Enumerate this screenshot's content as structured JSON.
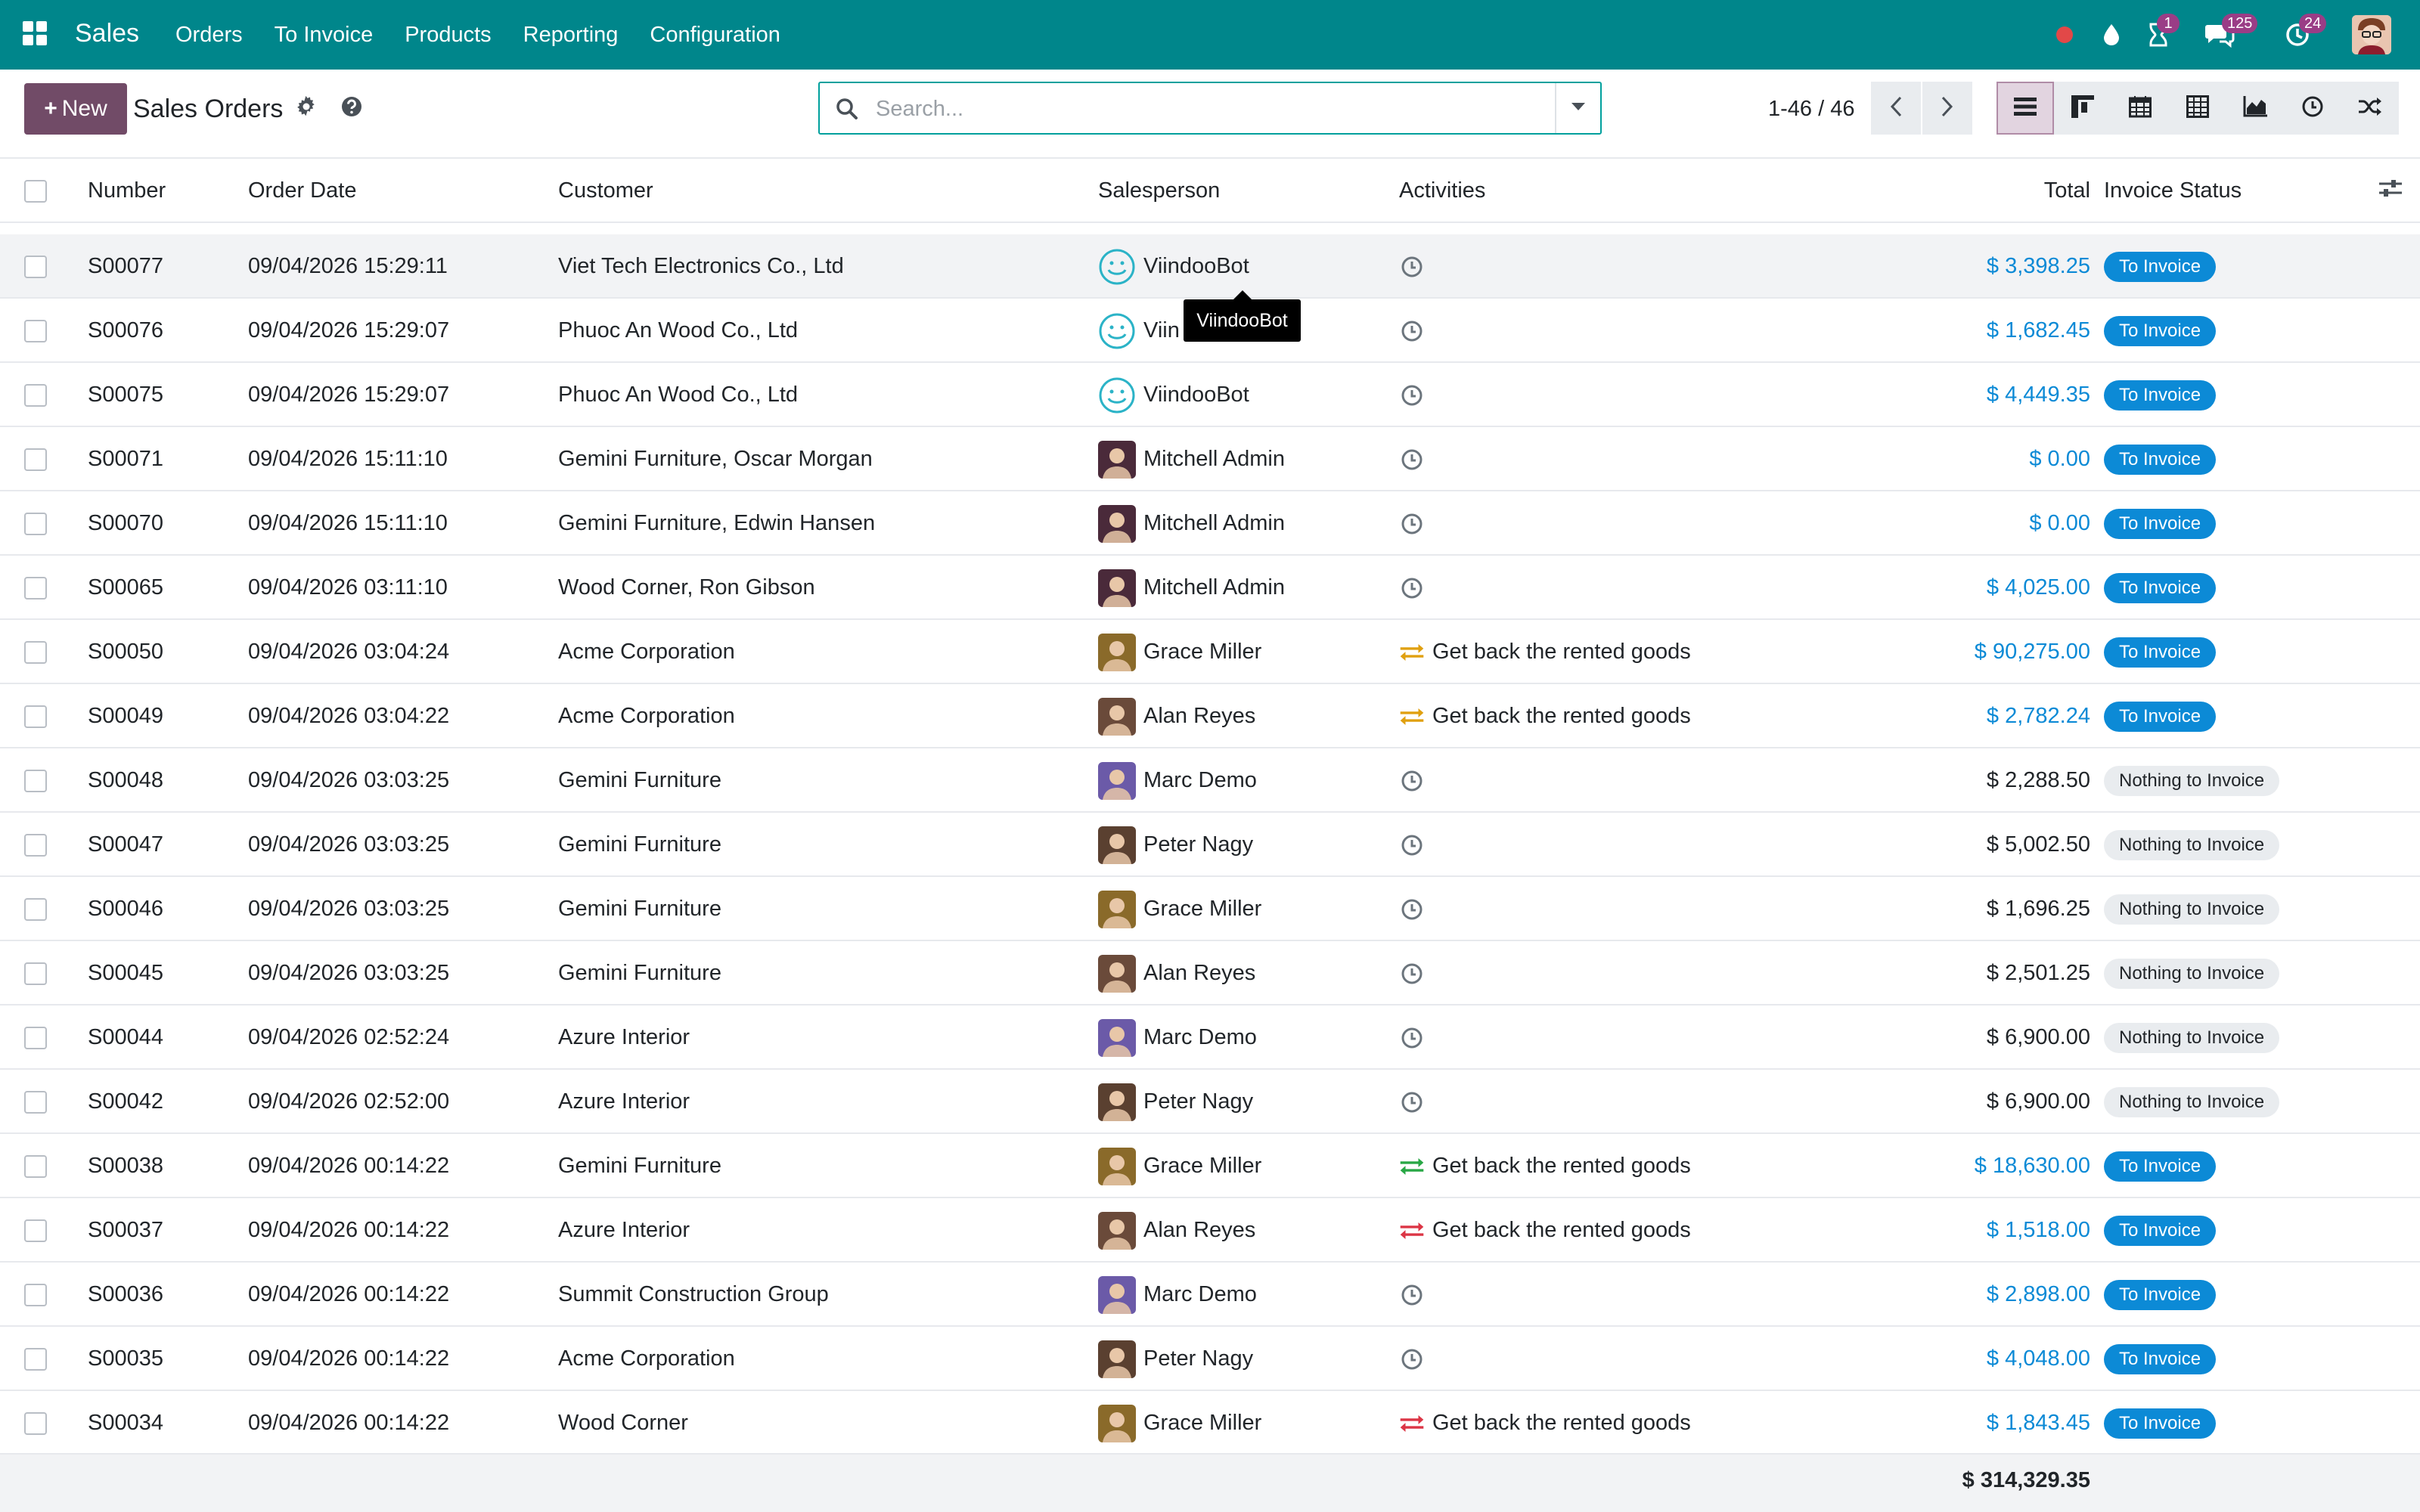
{
  "nav": {
    "app_name": "Sales",
    "menu": [
      "Orders",
      "To Invoice",
      "Products",
      "Reporting",
      "Configuration"
    ],
    "activity_badge": "1",
    "messages_badge": "125",
    "clock_badge": "24",
    "colors": {
      "navbar": "#00868b",
      "accent": "#714b67",
      "link": "#0c8ad6"
    }
  },
  "control_panel": {
    "new_label": "New",
    "title": "Sales Orders",
    "search_placeholder": "Search...",
    "pager": "1-46 / 46",
    "views": [
      "list-view-icon",
      "kanban-view-icon",
      "calendar-view-icon",
      "pivot-view-icon",
      "graph-view-icon",
      "activity-view-icon",
      "map-view-icon"
    ]
  },
  "table": {
    "headers": {
      "number": "Number",
      "order_date": "Order Date",
      "customer": "Customer",
      "salesperson": "Salesperson",
      "activities": "Activities",
      "total": "Total",
      "invoice_status": "Invoice Status"
    },
    "rows": [
      {
        "number": "S00077",
        "date": "09/04/2026 15:29:11",
        "customer": "Viet Tech Electronics Co., Ltd",
        "salesperson": "ViindooBot",
        "activity": "",
        "activity_icon": "clock",
        "total": "$ 3,398.25",
        "status": "To Invoice"
      },
      {
        "number": "S00076",
        "date": "09/04/2026 15:29:07",
        "customer": "Phuoc An Wood Co., Ltd",
        "salesperson": "Viin",
        "activity": "",
        "activity_icon": "clock",
        "total": "$ 1,682.45",
        "status": "To Invoice"
      },
      {
        "number": "S00075",
        "date": "09/04/2026 15:29:07",
        "customer": "Phuoc An Wood Co., Ltd",
        "salesperson": "ViindooBot",
        "activity": "",
        "activity_icon": "clock",
        "total": "$ 4,449.35",
        "status": "To Invoice"
      },
      {
        "number": "S00071",
        "date": "09/04/2026 15:11:10",
        "customer": "Gemini Furniture, Oscar Morgan",
        "salesperson": "Mitchell Admin",
        "activity": "",
        "activity_icon": "clock",
        "total": "$ 0.00",
        "status": "To Invoice"
      },
      {
        "number": "S00070",
        "date": "09/04/2026 15:11:10",
        "customer": "Gemini Furniture, Edwin Hansen",
        "salesperson": "Mitchell Admin",
        "activity": "",
        "activity_icon": "clock",
        "total": "$ 0.00",
        "status": "To Invoice"
      },
      {
        "number": "S00065",
        "date": "09/04/2026 03:11:10",
        "customer": "Wood Corner, Ron Gibson",
        "salesperson": "Mitchell Admin",
        "activity": "",
        "activity_icon": "clock",
        "total": "$ 4,025.00",
        "status": "To Invoice"
      },
      {
        "number": "S00050",
        "date": "09/04/2026 03:04:24",
        "customer": "Acme Corporation",
        "salesperson": "Grace Miller",
        "activity": "Get back the rented goods",
        "activity_icon": "exchange-orange",
        "total": "$ 90,275.00",
        "status": "To Invoice"
      },
      {
        "number": "S00049",
        "date": "09/04/2026 03:04:22",
        "customer": "Acme Corporation",
        "salesperson": "Alan Reyes",
        "activity": "Get back the rented goods",
        "activity_icon": "exchange-orange",
        "total": "$ 2,782.24",
        "status": "To Invoice"
      },
      {
        "number": "S00048",
        "date": "09/04/2026 03:03:25",
        "customer": "Gemini Furniture",
        "salesperson": "Marc Demo",
        "activity": "",
        "activity_icon": "clock",
        "total": "$ 2,288.50",
        "status": "Nothing to Invoice"
      },
      {
        "number": "S00047",
        "date": "09/04/2026 03:03:25",
        "customer": "Gemini Furniture",
        "salesperson": "Peter Nagy",
        "activity": "",
        "activity_icon": "clock",
        "total": "$ 5,002.50",
        "status": "Nothing to Invoice"
      },
      {
        "number": "S00046",
        "date": "09/04/2026 03:03:25",
        "customer": "Gemini Furniture",
        "salesperson": "Grace Miller",
        "activity": "",
        "activity_icon": "clock",
        "total": "$ 1,696.25",
        "status": "Nothing to Invoice"
      },
      {
        "number": "S00045",
        "date": "09/04/2026 03:03:25",
        "customer": "Gemini Furniture",
        "salesperson": "Alan Reyes",
        "activity": "",
        "activity_icon": "clock",
        "total": "$ 2,501.25",
        "status": "Nothing to Invoice"
      },
      {
        "number": "S00044",
        "date": "09/04/2026 02:52:24",
        "customer": "Azure Interior",
        "salesperson": "Marc Demo",
        "activity": "",
        "activity_icon": "clock",
        "total": "$ 6,900.00",
        "status": "Nothing to Invoice"
      },
      {
        "number": "S00042",
        "date": "09/04/2026 02:52:00",
        "customer": "Azure Interior",
        "salesperson": "Peter Nagy",
        "activity": "",
        "activity_icon": "clock",
        "total": "$ 6,900.00",
        "status": "Nothing to Invoice"
      },
      {
        "number": "S00038",
        "date": "09/04/2026 00:14:22",
        "customer": "Gemini Furniture",
        "salesperson": "Grace Miller",
        "activity": "Get back the rented goods",
        "activity_icon": "exchange-green",
        "total": "$ 18,630.00",
        "status": "To Invoice"
      },
      {
        "number": "S00037",
        "date": "09/04/2026 00:14:22",
        "customer": "Azure Interior",
        "salesperson": "Alan Reyes",
        "activity": "Get back the rented goods",
        "activity_icon": "exchange-red",
        "total": "$ 1,518.00",
        "status": "To Invoice"
      },
      {
        "number": "S00036",
        "date": "09/04/2026 00:14:22",
        "customer": "Summit Construction Group",
        "salesperson": "Marc Demo",
        "activity": "",
        "activity_icon": "clock",
        "total": "$ 2,898.00",
        "status": "To Invoice"
      },
      {
        "number": "S00035",
        "date": "09/04/2026 00:14:22",
        "customer": "Acme Corporation",
        "salesperson": "Peter Nagy",
        "activity": "",
        "activity_icon": "clock",
        "total": "$ 4,048.00",
        "status": "To Invoice"
      },
      {
        "number": "S00034",
        "date": "09/04/2026 00:14:22",
        "customer": "Wood Corner",
        "salesperson": "Grace Miller",
        "activity": "Get back the rented goods",
        "activity_icon": "exchange-red",
        "total": "$ 1,843.45",
        "status": "To Invoice"
      }
    ],
    "grand_total": "$ 314,329.35"
  },
  "tooltip": {
    "text": "ViindooBot"
  }
}
